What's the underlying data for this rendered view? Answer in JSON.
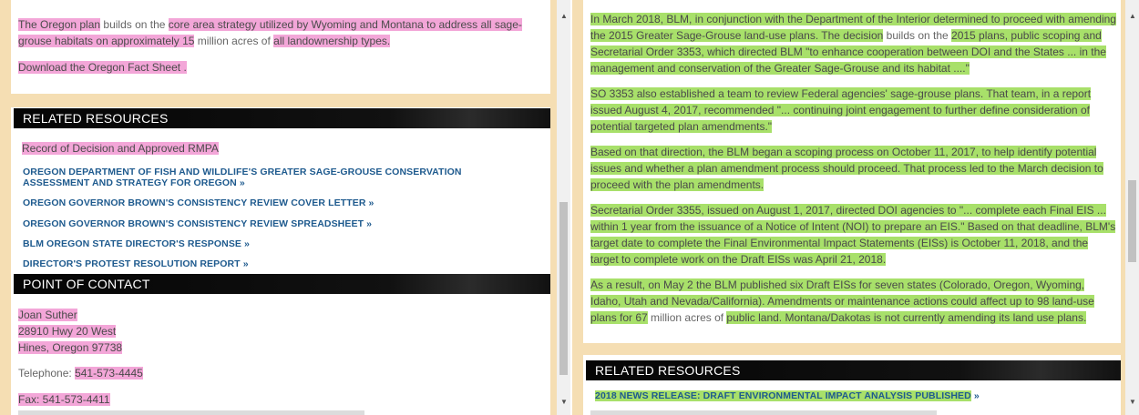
{
  "left": {
    "intro": {
      "p1_a": "The Oregon plan",
      "p1_b": " builds on the ",
      "p1_c": "core area strategy utilized by Wyoming and Montana to address all sage-grouse habitats on approximately 15",
      "p1_d": " million acres of ",
      "p1_e": "all landownership types.",
      "download": "Download the Oregon Fact Sheet ."
    },
    "related_title": "RELATED RESOURCES",
    "record_link": "Record of Decision and Approved RMPA",
    "links": [
      "OREGON DEPARTMENT OF FISH AND WILDLIFE'S GREATER SAGE-GROUSE CONSERVATION ASSESSMENT AND STRATEGY FOR OREGON  »",
      "OREGON GOVERNOR BROWN'S CONSISTENCY REVIEW COVER LETTER  »",
      "OREGON GOVERNOR BROWN'S CONSISTENCY REVIEW SPREADSHEET  »",
      "BLM OREGON STATE DIRECTOR'S RESPONSE  »",
      "DIRECTOR'S PROTEST RESOLUTION REPORT  »"
    ],
    "contact_title": "POINT OF CONTACT",
    "contact": {
      "name": "Joan Suther",
      "street": "28910 Hwy 20 West",
      "city": "Hines, Oregon  97738",
      "tel_label": "Telephone: ",
      "tel": "541-573-4445",
      "fax": "Fax:  541-573-4411"
    }
  },
  "right": {
    "p1": "In March 2018, BLM, in conjunction with the Department of the Interior determined to proceed with amending the 2015 Greater Sage-Grouse land-use plans. The decision",
    "p1_b": " builds on the ",
    "p1_c": "2015 plans, public scoping and Secretarial Order 3353, which directed BLM \"to enhance cooperation between DOI and the States ... in the management and conservation of the Greater Sage-Grouse and its habitat ....\"",
    "p2": "SO 3353 also established a team to review Federal agencies' sage-grouse plans. That team, in a report issued August 4, 2017, recommended \"... continuing joint engagement to further define consideration of potential targeted plan amendments.\"",
    "p3": "Based on that direction, the BLM began a scoping process on October 11, 2017, to help identify potential issues and whether a plan amendment process should proceed. That process led to the March decision to proceed with the plan amendments.",
    "p4": "Secretarial Order 3355, issued on August 1, 2017, directed DOI agencies to \"... complete each Final EIS ... within 1 year from the issuance of a Notice of Intent (NOI) to prepare an EIS.\" Based on that deadline, BLM's target date to complete the Final Environmental Impact Statements (EISs) is October 11, 2018, and the target to complete work on the Draft EISs was April 21, 2018.",
    "p5": "As a result, on May 2 the BLM published six Draft EISs for seven states (Colorado, Oregon, Wyoming, Idaho, Utah and Nevada/California). Amendments or maintenance actions could affect up to 98 land-use plans for 67",
    "p5_b": " million acres of ",
    "p5_c": "public land. Montana/Dakotas is not currently amending its land use plans.",
    "related_title": "RELATED RESOURCES",
    "news_link": "2018 NEWS RELEASE: DRAFT ENVIRONMENTAL IMPACT ANALYSIS PUBLISHED",
    "news_arrow": "  »"
  },
  "icons": {
    "up": "scroll-up-arrow-icon",
    "down": "scroll-down-arrow-icon"
  }
}
